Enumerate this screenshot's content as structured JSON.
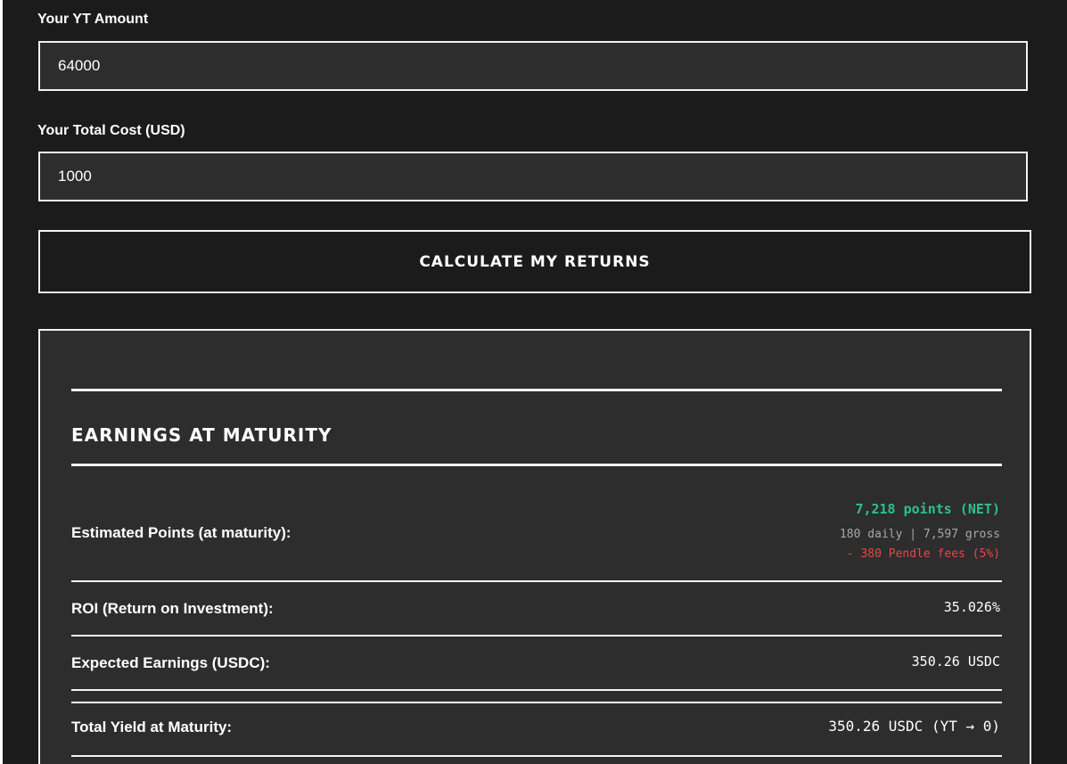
{
  "form": {
    "yt_label": "Your YT Amount",
    "yt_value": "64000",
    "cost_label": "Your Total Cost (USD)",
    "cost_value": "1000",
    "calculate_label": "CALCULATE MY RETURNS"
  },
  "results": {
    "title": "EARNINGS AT MATURITY",
    "points_label": "Estimated Points (at maturity):",
    "points_net": "7,218 points (NET)",
    "points_breakdown": "180 daily | 7,597 gross",
    "points_fees": "- 380 Pendle fees (5%)",
    "roi_label": "ROI (Return on Investment):",
    "roi_value": "35.026%",
    "earnings_label": "Expected Earnings (USDC):",
    "earnings_value": "350.26 USDC",
    "total_label": "Total Yield at Maturity:",
    "total_value": "350.26 USDC (YT → 0)"
  },
  "colors": {
    "background": "#1b1b1b",
    "panel": "#2d2d2d",
    "border": "#f2f2f2",
    "points_net": "#2fc08a",
    "fees": "#e04848"
  }
}
